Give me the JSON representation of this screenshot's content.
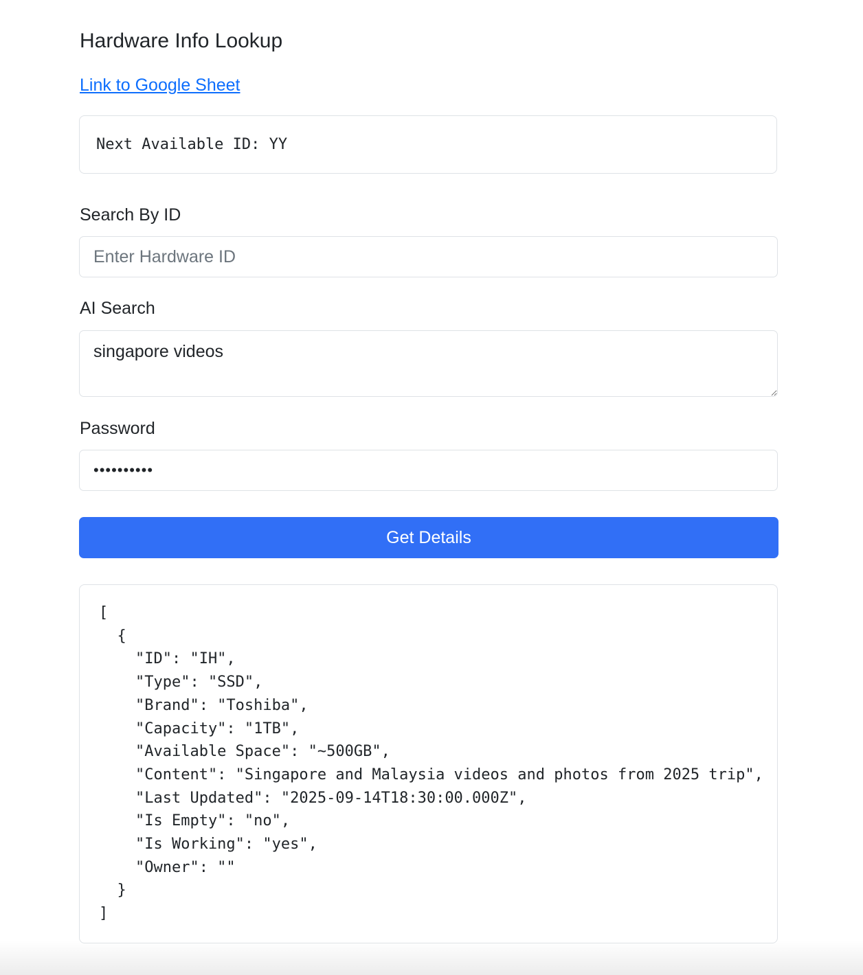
{
  "page": {
    "title": "Hardware Info Lookup",
    "sheet_link_label": "Link to Google Sheet"
  },
  "next_id": {
    "text": "Next Available ID: YY"
  },
  "search_by_id": {
    "label": "Search By ID",
    "placeholder": "Enter Hardware ID",
    "value": ""
  },
  "ai_search": {
    "label": "AI Search",
    "value": "singapore videos"
  },
  "password": {
    "label": "Password",
    "value": "••••••••••"
  },
  "submit": {
    "label": "Get Details"
  },
  "result": {
    "json_text": "[\n  {\n    \"ID\": \"IH\",\n    \"Type\": \"SSD\",\n    \"Brand\": \"Toshiba\",\n    \"Capacity\": \"1TB\",\n    \"Available Space\": \"~500GB\",\n    \"Content\": \"Singapore and Malaysia videos and photos from 2025 trip\",\n    \"Last Updated\": \"2025-09-14T18:30:00.000Z\",\n    \"Is Empty\": \"no\",\n    \"Is Working\": \"yes\",\n    \"Owner\": \"\"\n  }\n]"
  },
  "colors": {
    "accent": "#316ff6",
    "link": "#0d6efd",
    "border": "#dee2e6",
    "text": "#212529"
  }
}
